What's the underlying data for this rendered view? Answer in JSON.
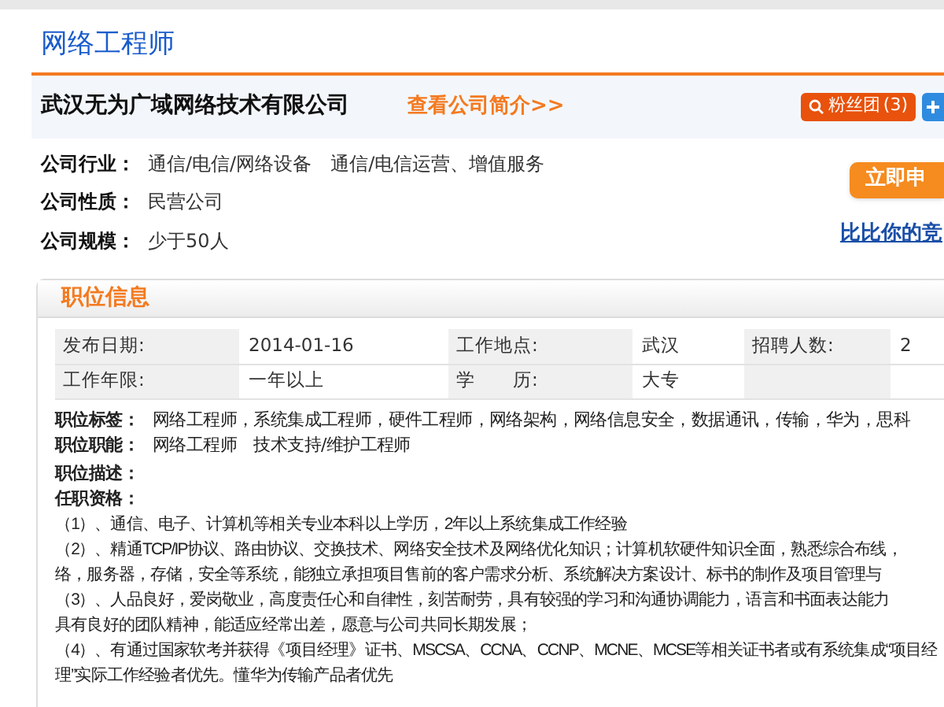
{
  "job_title": "网络工程师",
  "company": {
    "name": "武汉无为广域网络技术有限公司",
    "intro_link": "查看公司简介>>",
    "fans_button": "粉丝团",
    "fans_count": "(3)"
  },
  "company_info": [
    {
      "label": "公司行业：",
      "value": "通信/电信/网络设备　通信/电信运营、增值服务"
    },
    {
      "label": "公司性质：",
      "value": "民营公司"
    },
    {
      "label": "公司规模：",
      "value": "少于50人"
    }
  ],
  "apply_button": "立即申",
  "compare_link": "比比你的竞",
  "section_title": "职位信息",
  "info_table": [
    [
      {
        "label": "发布日期:",
        "value": "2014-01-16"
      },
      {
        "label": "工作地点:",
        "value": "武汉"
      },
      {
        "label": "招聘人数:",
        "value": "2"
      }
    ],
    [
      {
        "label": "工作年限:",
        "value": "一年以上"
      },
      {
        "label": "学　　历:",
        "value": "大专"
      }
    ]
  ],
  "tags": {
    "label": "职位标签：",
    "value": "网络工程师，系统集成工程师，硬件工程师，网络架构，网络信息安全，数据通讯，传输，华为，思科"
  },
  "functions": {
    "label": "职位职能：",
    "value": "网络工程师　技术支持/维护工程师"
  },
  "description_label": "职位描述：",
  "requirements_label": "任职资格：",
  "requirements": [
    "（1）、通信、电子、计算机等相关专业本科以上学历，2年以上系统集成工作经验",
    "（2）、精通TCP/IP协议、路由协议、交换技术、网络安全技术及网络优化知识；计算机软硬件知识全面，熟悉综合布线，",
    "络，服务器，存储，安全等系统，能独立承担项目售前的客户需求分析、系统解决方案设计、标书的制作及项目管理与",
    "（3）、人品良好，爱岗敬业，高度责任心和自律性，刻苦耐劳，具有较强的学习和沟通协调能力，语言和书面表达能力",
    "具有良好的团队精神，能适应经常出差，愿意与公司共同长期发展；",
    "（4）、有通过国家软考并获得《项目经理》证书、MSCSA、CCNA、CCNP、MCNE、MCSE等相关证书者或有系统集成“项目经",
    "理”实际工作经验者优先。懂华为传输产品者优先"
  ]
}
